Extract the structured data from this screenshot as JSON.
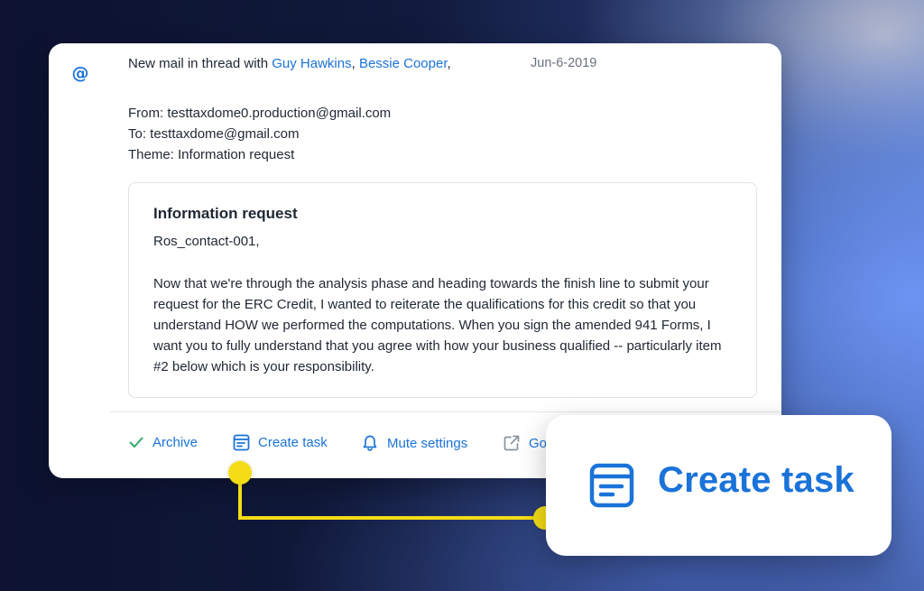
{
  "thread": {
    "prefix": "New mail in thread with",
    "participants": [
      "Guy Hawkins",
      "Bessie Cooper"
    ],
    "separator": ",",
    "date": "Jun-6-2019"
  },
  "meta": {
    "from": "From: testtaxdome0.production@gmail.com",
    "to": "To: testtaxdome@gmail.com",
    "theme": "Theme: Information request"
  },
  "message": {
    "title": "Information request",
    "greeting": "Ros_contact-001,",
    "body": "Now that we're through the analysis phase and heading towards the finish line to submit your request for the ERC Credit, I wanted to reiterate the qualifications for this credit so that you understand HOW we performed the computations. When you sign the amended 941 Forms, I want you to fully understand that you agree with how your business qualified -- particularly item #2 below which is your responsibility."
  },
  "actions": [
    {
      "label": "Archive",
      "icon": "check-icon"
    },
    {
      "label": "Create task",
      "icon": "task-icon"
    },
    {
      "label": "Mute settings",
      "icon": "bell-icon"
    },
    {
      "label": "Go",
      "icon": "external-link-icon"
    }
  ],
  "zoom": {
    "label": "Create task",
    "icon": "task-icon"
  },
  "colors": {
    "accent": "#1a73d9",
    "highlight": "#f4dc16"
  }
}
